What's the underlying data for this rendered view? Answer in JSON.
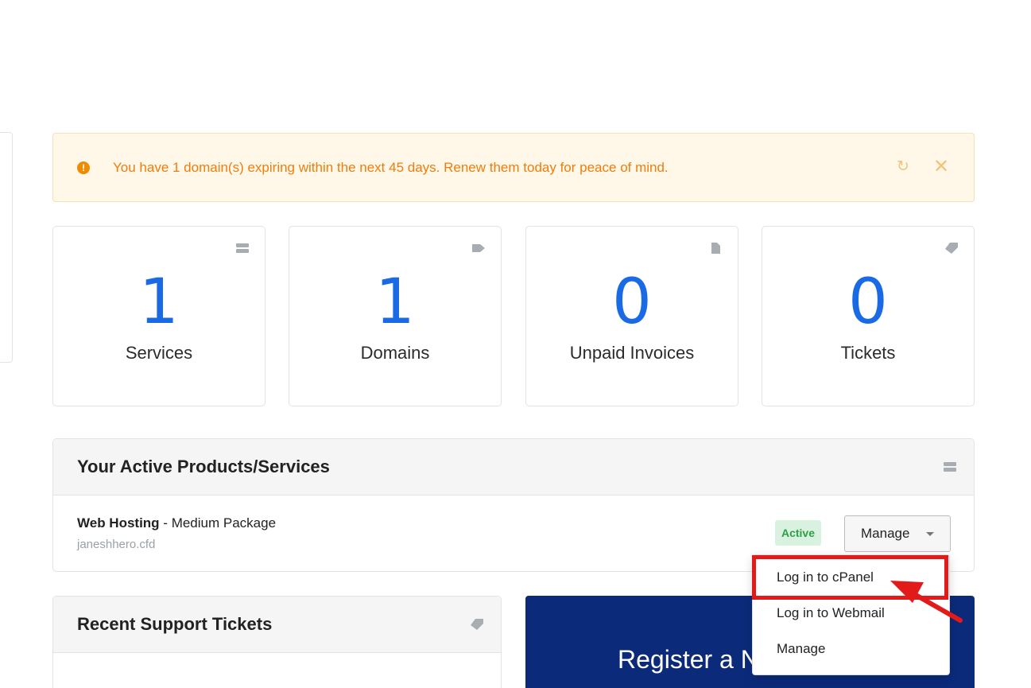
{
  "alert": {
    "message": "You have 1 domain(s) expiring within the next 45 days. Renew them today for peace of mind.",
    "icon": "exclamation-circle-icon",
    "refresh_icon": "refresh-icon",
    "close_icon": "close-icon"
  },
  "stats": [
    {
      "value": "1",
      "label": "Services",
      "icon": "server-icon"
    },
    {
      "value": "1",
      "label": "Domains",
      "icon": "tag-icon"
    },
    {
      "value": "0",
      "label": "Unpaid Invoices",
      "icon": "document-icon"
    },
    {
      "value": "0",
      "label": "Tickets",
      "icon": "ticket-icon"
    }
  ],
  "products": {
    "title": "Your Active Products/Services",
    "item": {
      "group": "Web Hosting",
      "separator": " - ",
      "package": "Medium Package",
      "domain": "janeshhero.cfd",
      "status": "Active",
      "manage_label": "Manage"
    }
  },
  "dropdown": {
    "items": [
      "Log in to cPanel",
      "Log in to Webmail",
      "Manage"
    ]
  },
  "tickets": {
    "title": "Recent Support Tickets"
  },
  "promo": {
    "text": "Register a New Domain"
  },
  "colors": {
    "accent": "#1a6ae6",
    "alert_text": "#ef7d0d",
    "alert_bg": "#fff8e8",
    "status_active": "#2e9e48",
    "promo_bg": "#0b2a7a",
    "highlight": "#e21a1a"
  }
}
